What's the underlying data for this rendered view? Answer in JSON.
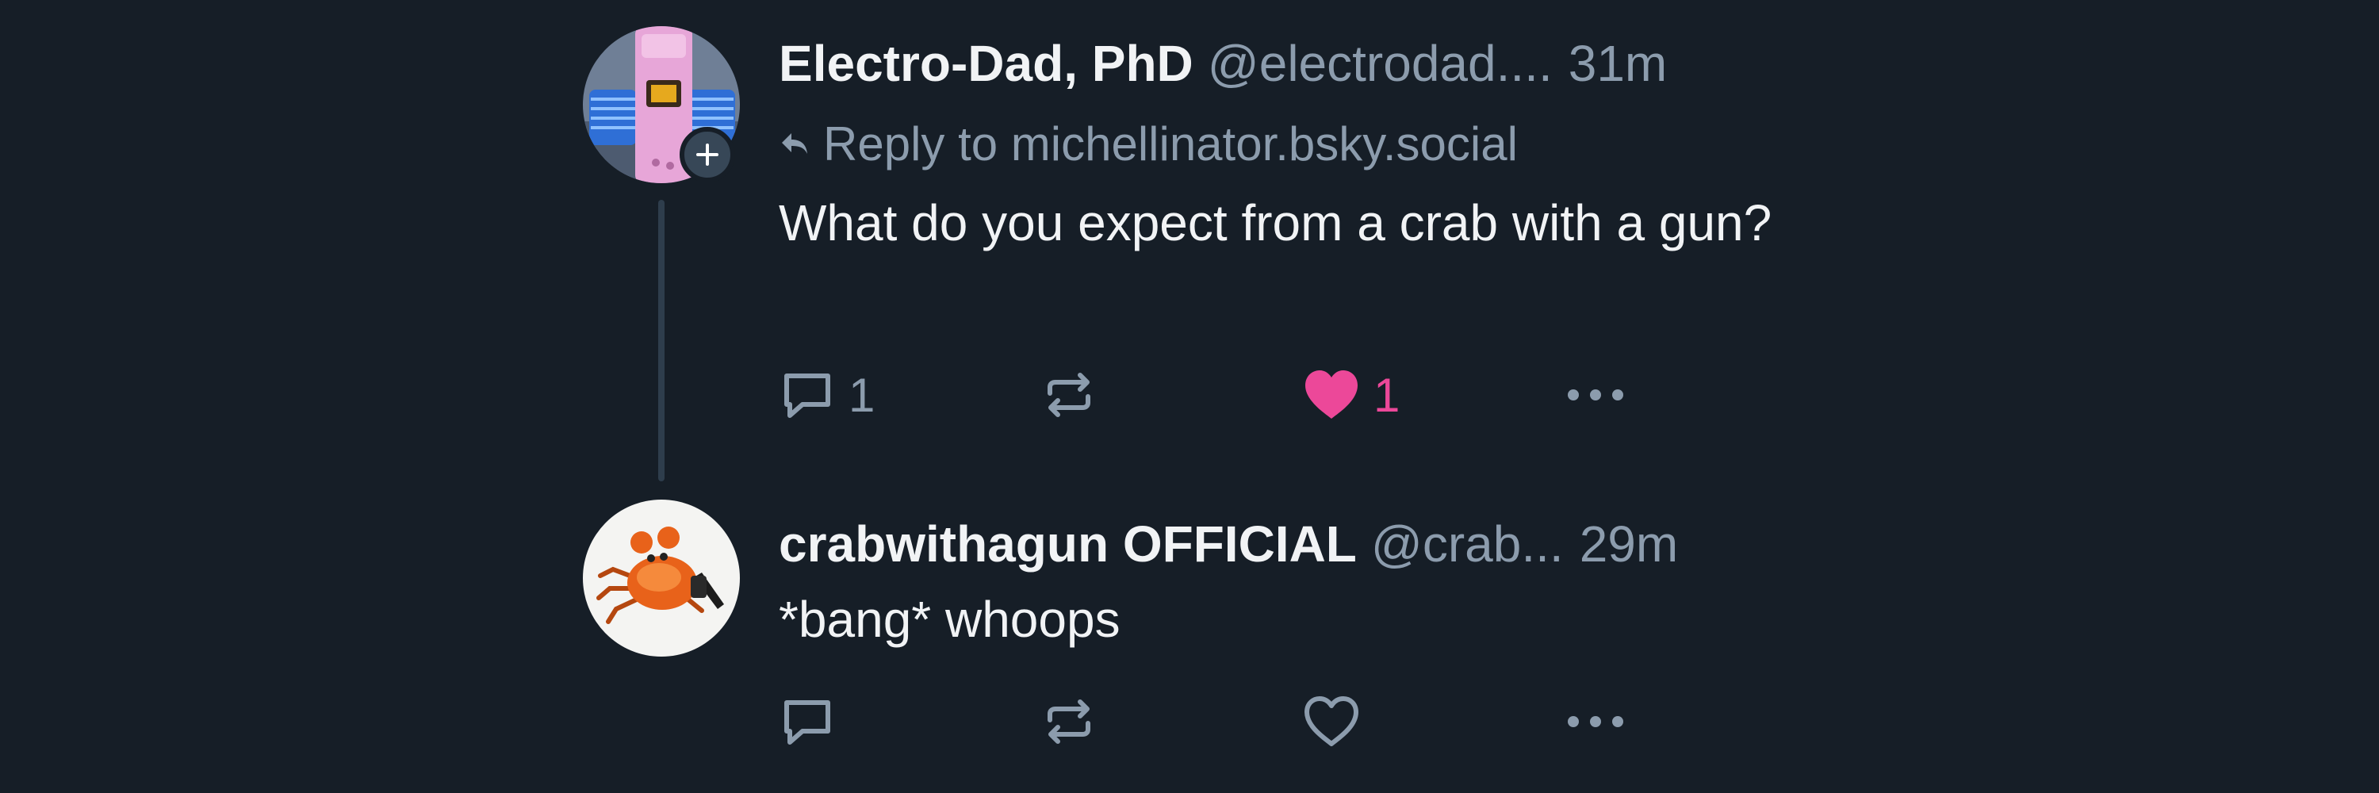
{
  "colors": {
    "background": "#161e27",
    "text_primary": "#f1f3f5",
    "text_secondary": "#8c9cad",
    "like_active": "#ec4899",
    "thread_line": "#2e3d4c"
  },
  "posts": [
    {
      "avatar_icon": "lighter-avatar",
      "follow_icon": "plus-icon",
      "display_name": "Electro-Dad, PhD",
      "handle": "@electrodad....",
      "time": "31m",
      "reply_to_icon": "reply-arrow-icon",
      "reply_to": "Reply to michellinator.bsky.social",
      "text": "What do you expect from a crab with a gun?",
      "actions": {
        "reply_icon": "comment-icon",
        "reply_count": "1",
        "repost_icon": "repost-icon",
        "like_icon": "heart-filled-icon",
        "like_count": "1",
        "liked": true,
        "more_icon": "more-dots-icon"
      }
    },
    {
      "avatar_icon": "crab-avatar",
      "display_name": "crabwithagun OFFICIAL",
      "handle": "@crab...",
      "time": "29m",
      "text": "*bang* whoops",
      "actions": {
        "reply_icon": "comment-icon",
        "reply_count": "",
        "repost_icon": "repost-icon",
        "like_icon": "heart-outline-icon",
        "like_count": "",
        "liked": false,
        "more_icon": "more-dots-icon"
      }
    }
  ]
}
